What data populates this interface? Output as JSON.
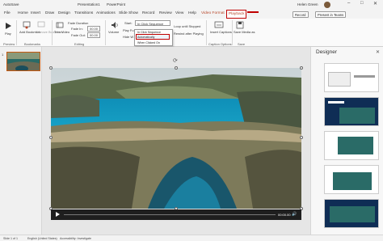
{
  "titlebar": {
    "autosave": "AutoSave",
    "file_name": "Presentation1",
    "app_name": "PowerPoint",
    "user_name": "Helen Green"
  },
  "tabs": [
    "File",
    "Home",
    "Insert",
    "Draw",
    "Design",
    "Transitions",
    "Animations",
    "Slide Show",
    "Record",
    "Review",
    "View",
    "Help",
    "Video Format",
    "Playback"
  ],
  "active_tab": "Playback",
  "top_buttons": {
    "record": "Record",
    "present_teams": "Present in Teams"
  },
  "ribbon": {
    "play_label": "Play",
    "add_bookmark": "Add Bookmark",
    "remove_bookmark": "Remove Bookmark",
    "trim_video": "Trim Video",
    "fade_duration": "Fade Duration",
    "fade_in": "Fade In:",
    "fade_in_value": "00.00",
    "fade_out": "Fade Out:",
    "fade_out_value": "00.00",
    "volume": "Volume",
    "start": "Start:",
    "start_value": "In Click Sequence",
    "hide": "Hide W",
    "full": "Play Fu",
    "loop": "Loop until Stopped",
    "rewind": "Rewind after Playing",
    "insert_captions": "Insert Captions",
    "save_media_as": "Save Media as",
    "groups": {
      "preview": "Preview",
      "bookmarks": "Bookmarks",
      "editing": "Editing",
      "caption": "Caption Options",
      "save": "Save"
    }
  },
  "start_dropdown": {
    "options": [
      "In Click Sequence",
      "Automatically",
      "When Clicked On"
    ],
    "highlighted": "Automatically"
  },
  "slide_pane": {
    "slide_number": "1"
  },
  "media_bar": {
    "time": "00:00.00"
  },
  "designer": {
    "title": "Designer"
  },
  "statusbar": {
    "slide_info": "Slide 1 of 1",
    "language": "English (United States)",
    "accessibility": "Accessibility: Investigate"
  },
  "colors": {
    "accent": "#b7472a",
    "highlight_border": "#c00000",
    "sea": "#1aa7c9"
  }
}
